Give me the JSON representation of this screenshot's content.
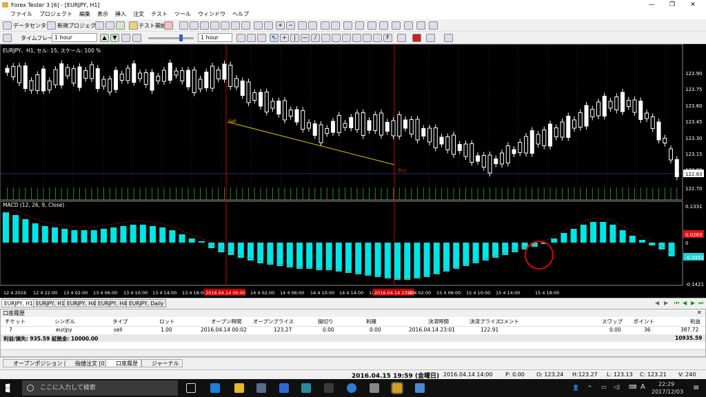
{
  "window": {
    "title": "Forex Tester 3  [6] - [EURJPY, H1]"
  },
  "menu": [
    "ファイル",
    "プロジェクト",
    "編集",
    "表示",
    "挿入",
    "注文",
    "テスト",
    "ツール",
    "ウィンドウ",
    "ヘルプ"
  ],
  "toolbar1": {
    "data_center": "データセンター",
    "new_project": "新規プロジェクト",
    "test_start": "テスト開始"
  },
  "toolbar2": {
    "timeframe_label": "タイムフレーム",
    "timeframe_value": "1 hour",
    "speed_value": "1 hour"
  },
  "chart": {
    "title": "EURJPY、H1, セル: 15, スケール: 100 %",
    "price_ticks": [
      "123.90",
      "123.75",
      "123.60",
      "123.45",
      "123.30",
      "123.15",
      "123.00",
      "122.83",
      "122.70"
    ],
    "current_price": "122.83",
    "macd_title": "MACD (12, 26, 9, Close)",
    "macd_ticks": [
      "0.1331",
      "0.0283",
      "0",
      "-0.0452",
      "-0.1421"
    ],
    "time_labels": [
      "12 4 2016",
      "12 4 22:00",
      "13 4 02:00",
      "13 4 06:00",
      "13 4 10:00",
      "13 4 14:00",
      "13 4 18:00",
      "2016.04.14 00:00",
      "14 4 02:00",
      "14 4 06:00",
      "14 4 10:00",
      "14 4 14:00",
      "14 4 18:00",
      "2016.04.14 23:00",
      "15 4 02:00",
      "15 4 06:00",
      "15 4 10:00",
      "15 4 14:00",
      "15 4 18:00"
    ],
    "trade_sell_label": "Sell",
    "trade_buy_label": "Buy",
    "colors": {
      "bull": "#ffffff",
      "bear": "#ffffff",
      "macd": "#00e5e5",
      "signal": "#cc2020",
      "vline": "#cc0000",
      "trade": "#e0c000"
    }
  },
  "chart_tabs": [
    "EURJPY, H1",
    "EURJPY, H1",
    "EURJPY, H4",
    "EURJPY, H4",
    "EURJPY, Daily"
  ],
  "history": {
    "header": "口座履歴",
    "columns": [
      "チケット",
      "シンボル",
      "タイプ",
      "ロット",
      "オープン時間",
      "オープンプライス",
      "損切り",
      "利確",
      "決済時間",
      "決済プライス",
      "コメント",
      "スワップ",
      "ポイント",
      "利益"
    ],
    "row": [
      "7",
      "eurjpy",
      "sell",
      "1.00",
      "2016.04.14 00:02",
      "123.27",
      "0.00",
      "0.00",
      "2016.04.14 23:01",
      "122.91",
      "",
      "0.00",
      "36",
      "387.72"
    ],
    "summary": "利益/損失: 935.59 証拠金: 10000.00",
    "total": "10935.59"
  },
  "bottom_tabs": [
    "オープンポジション [0]",
    "指値注文 [0]",
    "口座履歴",
    "ジャーナル"
  ],
  "status": {
    "datetime": "2016.04.15 19:59 (金曜日)",
    "bar_time": "2016.04.14 14:00",
    "p": "P: 0.00",
    "o": "O: 123.24",
    "h": "H:123.27",
    "l": "L: 123.13",
    "c": "C: 123.21",
    "v": "V: 240"
  },
  "taskbar": {
    "search_placeholder": "ここに入力して検索",
    "time": "22:29",
    "date": "2017/12/03",
    "ime": "A"
  }
}
